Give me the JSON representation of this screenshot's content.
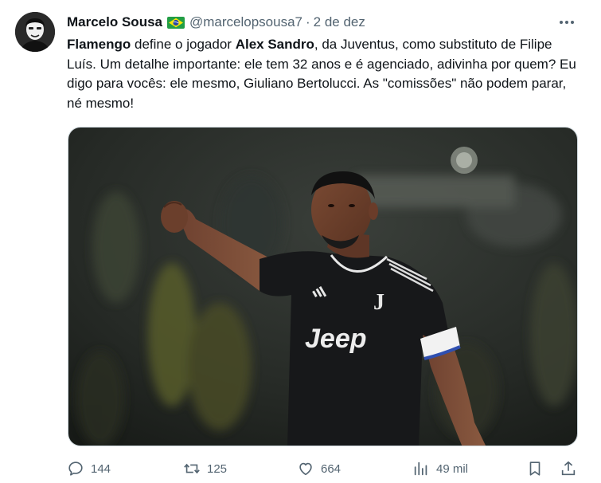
{
  "tweet": {
    "author_name": "Marcelo Sousa",
    "author_flag": "brazil-flag",
    "author_handle": "@marcelopsousa7",
    "separator": "·",
    "date": "2 de dez",
    "text": {
      "part1_bold": "Flamengo",
      "part2": " define o jogador ",
      "part3_bold": "Alex Sandro",
      "part4": ", da Juventus, como substituto de Filipe Luís. Um detalhe importante: ele tem 32 anos e é agenciado, adivinha por quem? Eu digo para vocês: ele mesmo, Giuliano Bertolucci. As \"comissões\" não podem parar, né mesmo!"
    },
    "media": {
      "jersey_sponsor": "Jeep",
      "description_icon": "photo"
    },
    "actions": {
      "replies": "144",
      "reposts": "125",
      "likes": "664",
      "views": "49 mil"
    }
  },
  "colors": {
    "text_primary": "#0f1419",
    "text_secondary": "#536471",
    "border": "#cfd9de"
  }
}
